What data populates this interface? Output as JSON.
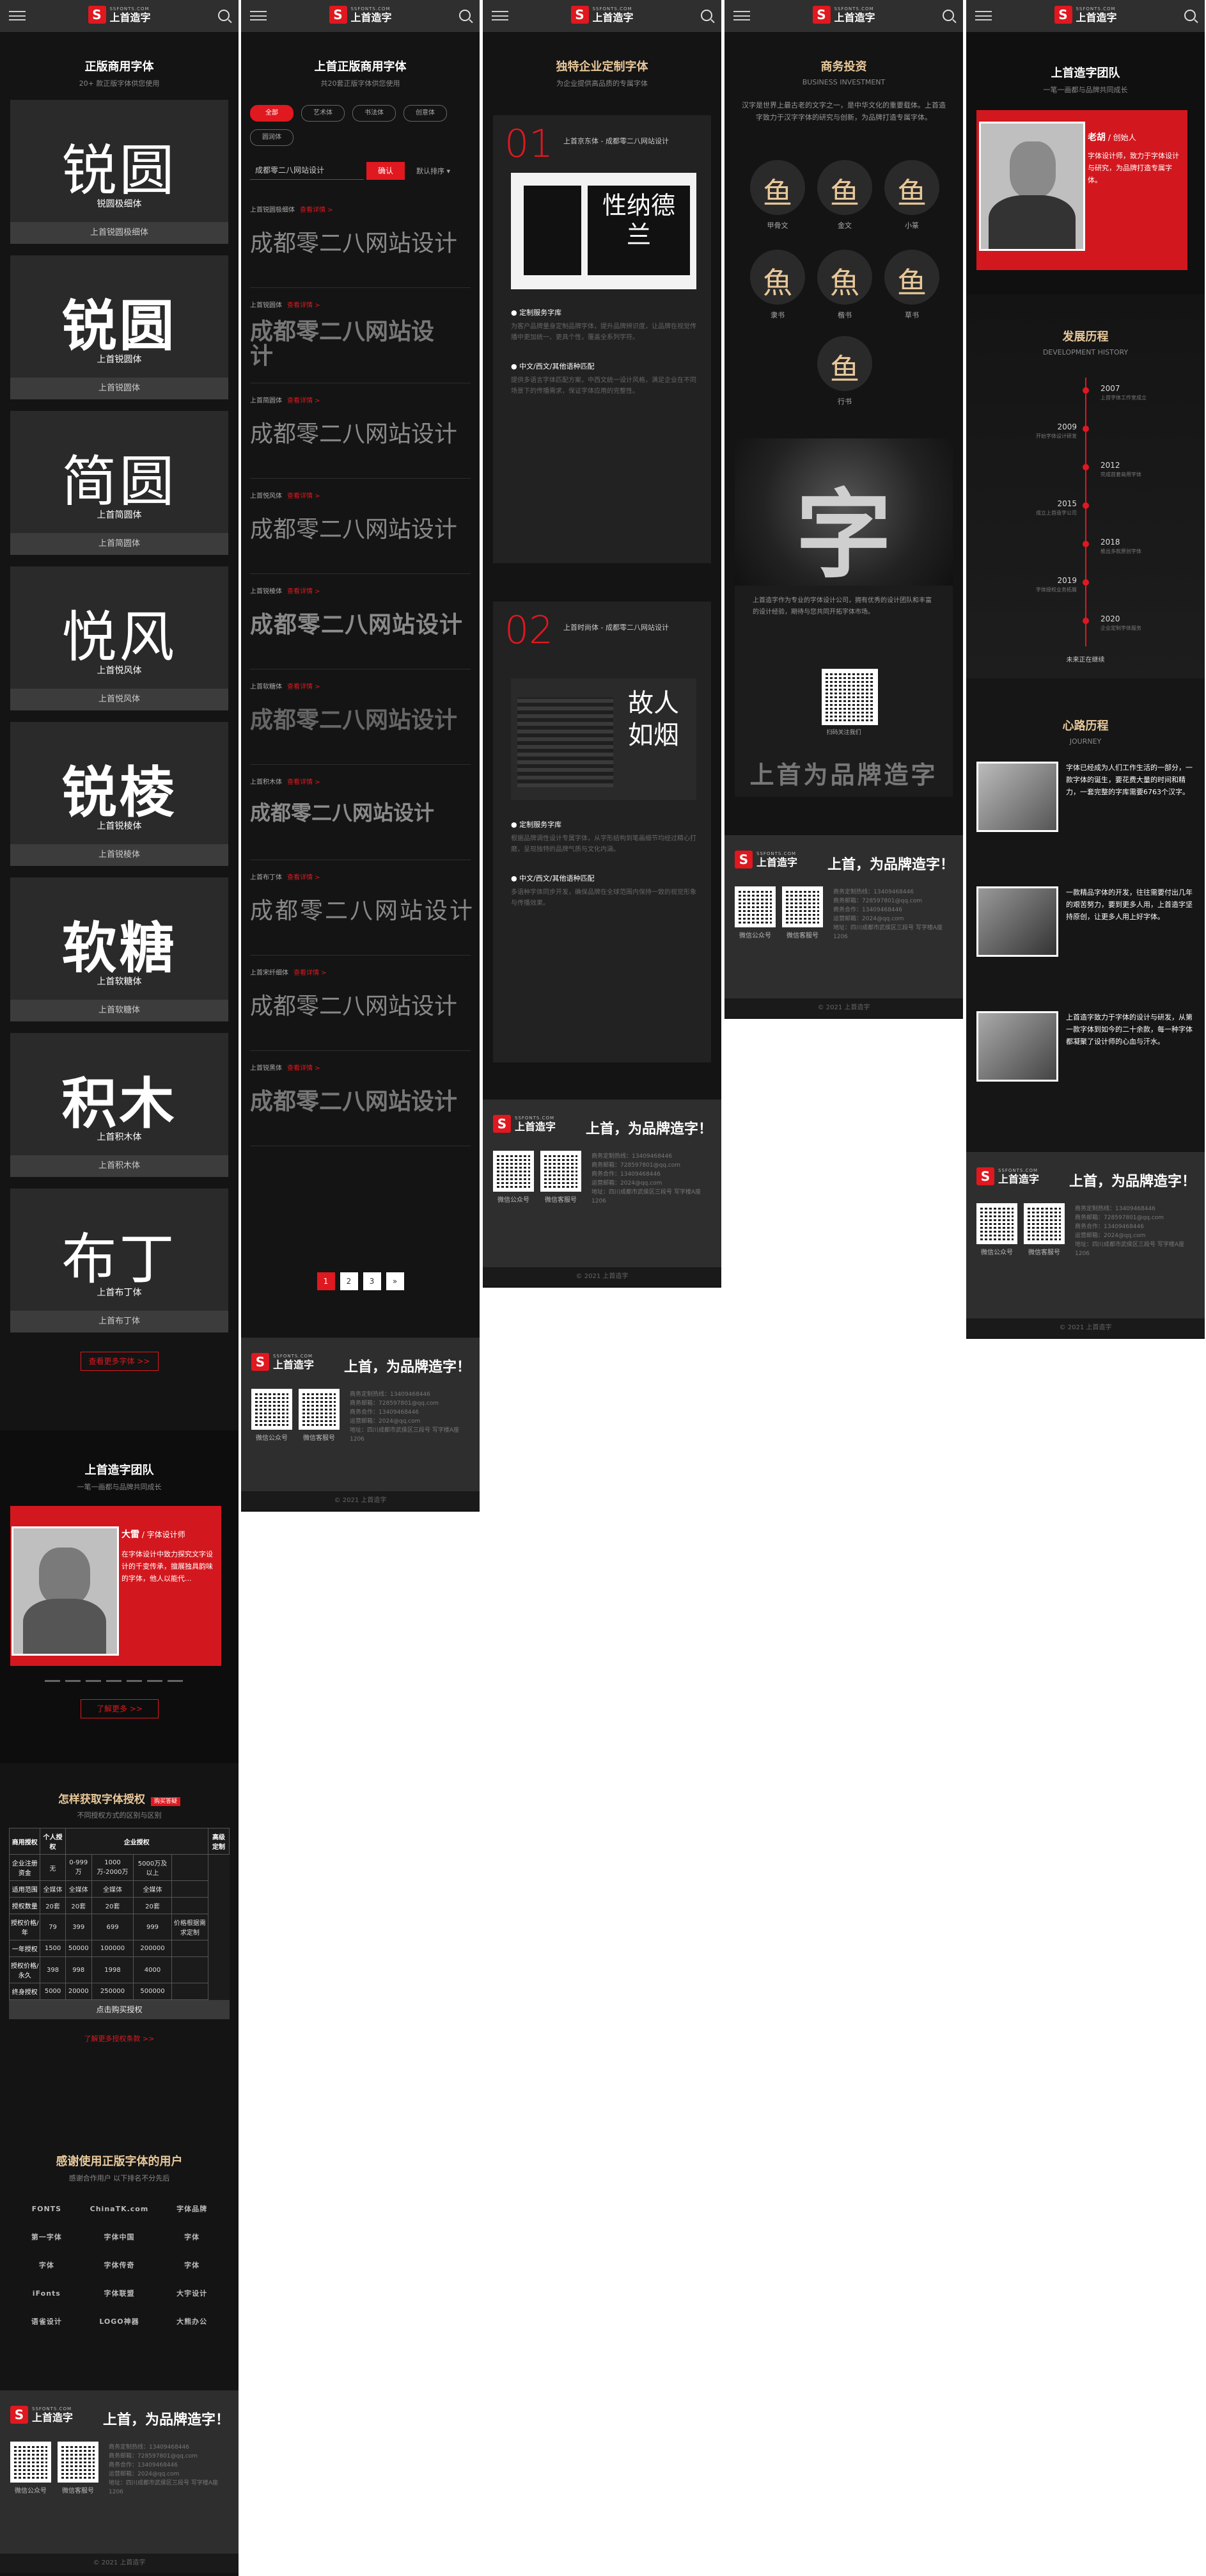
{
  "common": {
    "logo_domain": "SSFONTS.COM",
    "logo_name": "上首造字",
    "footer_slogan": "上首，为品牌造字！",
    "qr1_label": "微信公众号",
    "qr2_label": "微信客服号",
    "footer_info": [
      "商务定制热线：13409468446",
      "商务邮箱：728597801@qq.com",
      "商务合作：13409468446",
      "运营邮箱：2024@qq.com",
      "地址：四川成都市武侯区三段号 写字楼A座1206"
    ],
    "copyright": "© 2021 上首造字"
  },
  "p1": {
    "title": "正版商用字体",
    "subtitle": "20+ 款正版字体供您使用",
    "fonts": [
      {
        "big": "锐圆",
        "small": "锐圆极细体",
        "cap": "上首锐圆极细体"
      },
      {
        "big": "锐圆",
        "small": "上首锐圆体",
        "cap": "上首锐圆体"
      },
      {
        "big": "简圆",
        "small": "上首简圆体",
        "cap": "上首简圆体"
      },
      {
        "big": "悦风",
        "small": "上首悦风体",
        "cap": "上首悦风体"
      },
      {
        "big": "锐棱",
        "small": "上首锐棱体",
        "cap": "上首锐棱体"
      },
      {
        "big": "软糖",
        "small": "上首软糖体",
        "cap": "上首软糖体"
      },
      {
        "big": "积木",
        "small": "上首积木体",
        "cap": "上首积木体"
      },
      {
        "big": "布丁",
        "small": "上首布丁体",
        "cap": "上首布丁体"
      }
    ],
    "more_btn": "查看更多字体 >>",
    "team_title": "上首造字团队",
    "team_sub": "一笔一画都与品牌共同成长",
    "team_name": "大雷",
    "team_role": "/ 字体设计师",
    "team_desc": "在字体设计中致力探究文字设计的千变传承，擅展独具韵味的字体，他人以能代...",
    "team_btn": "了解更多 >>",
    "license_title": "怎样获取字体授权",
    "license_badge": "购买答疑",
    "license_sub": "不同授权方式的区别与区别",
    "table_head": [
      "商用授权",
      "个人授权",
      "企业授权",
      "",
      "",
      "高级定制"
    ],
    "table_rows": [
      [
        "企业注册资金",
        "无",
        "0-999万",
        "1000万-2000万",
        "5000万及以上",
        ""
      ],
      [
        "适用范围",
        "全媒体",
        "全媒体",
        "全媒体",
        "全媒体",
        ""
      ],
      [
        "授权数量",
        "20套",
        "20套",
        "20套",
        "20套",
        ""
      ],
      [
        "授权价格/年",
        "79",
        "399",
        "699",
        "999",
        "价格根据需求定制"
      ],
      [
        "一年授权",
        "1500",
        "50000",
        "100000",
        "200000",
        ""
      ],
      [
        "授权价格/永久",
        "398",
        "998",
        "1998",
        "4000",
        ""
      ],
      [
        "终身授权",
        "5000",
        "20000",
        "250000",
        "500000",
        ""
      ]
    ],
    "buy_btn": "点击购买授权",
    "license_link": "了解更多授权条款 >>",
    "partners_title": "感谢使用正版字体的用户",
    "partners_sub": "感谢合作用户 以下排名不分先后",
    "partners": [
      "FONTS",
      "ChinaTK.com",
      "字体品牌",
      "第一字体",
      "字体中国",
      "字体",
      "字体",
      "字体传奇",
      "字体",
      "iFonts",
      "字体联盟",
      "大宇设计",
      "语雀设计",
      "LOGO神器",
      "大熊办公"
    ]
  },
  "p2": {
    "title": "上首正版商用字体",
    "subtitle": "共20套正版字体供您使用",
    "tags": [
      "全部",
      "艺术体",
      "书法体",
      "创意体",
      "圆润体"
    ],
    "input_value": "成都零二八网站设计",
    "ok": "确认",
    "sort": "默认排序 ▾",
    "list": [
      {
        "name": "上首锐圆极细体",
        "link": "查看详情 >",
        "preview": "成都零二八网站设计"
      },
      {
        "name": "上首锐圆体",
        "link": "查看详情 >",
        "preview": "成都零二八网站设计"
      },
      {
        "name": "上首简圆体",
        "link": "查看详情 >",
        "preview": "成都零二八网站设计"
      },
      {
        "name": "上首悦风体",
        "link": "查看详情 >",
        "preview": "成都零二八网站设计"
      },
      {
        "name": "上首锐棱体",
        "link": "查看详情 >",
        "preview": "成都零二八网站设计"
      },
      {
        "name": "上首软糖体",
        "link": "查看详情 >",
        "preview": "成都零二八网站设计"
      },
      {
        "name": "上首积木体",
        "link": "查看详情 >",
        "preview": "成都零二八网站设计"
      },
      {
        "name": "上首布丁体",
        "link": "查看详情 >",
        "preview": "成都零二八网站设计"
      },
      {
        "name": "上首宋纤细体",
        "link": "查看详情 >",
        "preview": "成都零二八网站设计"
      },
      {
        "name": "上首锐黑体",
        "link": "查看详情 >",
        "preview": "成都零二八网站设计"
      }
    ],
    "pages": [
      "1",
      "2",
      "3",
      "»"
    ]
  },
  "p3": {
    "title": "独特企业定制字体",
    "subtitle": "为企业提供高品质的专属字体",
    "case1_num": "01",
    "case1_title": "上首京东体 - 成都零二八网站设计",
    "case1_img_text": "性纳德兰",
    "case1_b1": "● 定制服务字库",
    "case1_p1": "为客户品牌量身定制品牌字体，提升品牌辨识度，让品牌在视觉传播中更加统一、更具个性，覆盖全系列字符。",
    "case1_b2": "● 中文/西文/其他语种匹配",
    "case1_p2": "提供多语言字体匹配方案，中西文统一设计风格，满足企业在不同场景下的传播需求，保证字体应用的完整性。",
    "case2_num": "02",
    "case2_title": "上首时尚体 - 成都零二八网站设计",
    "case2_img_text": "故人如烟",
    "case2_b1": "● 定制服务字库",
    "case2_p1": "根据品牌调性设计专属字体，从字形结构到笔画细节均经过精心打磨，呈现独特的品牌气质与文化内涵。",
    "case2_b2": "● 中文/西文/其他语种匹配",
    "case2_p2": "多语种字体同步开发，确保品牌在全球范围内保持一致的视觉形象与传播效果。"
  },
  "p4": {
    "title": "商务投资",
    "subtitle": "BUSINESS INVESTMENT",
    "intro": "汉字是世界上最古老的文字之一，是中华文化的重要载体。上首造字致力于汉字字体的研究与创新，为品牌打造专属字体。",
    "scripts": [
      {
        "glyph": "鱼",
        "label": "甲骨文"
      },
      {
        "glyph": "鱼",
        "label": "金文"
      },
      {
        "glyph": "鱼",
        "label": "小篆"
      },
      {
        "glyph": "魚",
        "label": "隶书"
      },
      {
        "glyph": "魚",
        "label": "楷书"
      },
      {
        "glyph": "鱼",
        "label": "草书"
      },
      {
        "glyph": "鱼",
        "label": "行书"
      }
    ],
    "banner_char": "字",
    "invest_text": "上首造字作为专业的字体设计公司，拥有优秀的设计团队和丰富的设计经验，期待与您共同开拓字体市场。",
    "qr_caption": "扫码关注我们",
    "banner_slogan": "上首为品牌造字"
  },
  "p5": {
    "team_title": "上首造字团队",
    "team_sub": "一笔一画都与品牌共同成长",
    "name": "老胡",
    "role": "/ 创始人",
    "desc": "字体设计师，致力于字体设计与研究，为品牌打造专属字体。",
    "history_title": "发展历程",
    "history_sub": "DEVELOPMENT HISTORY",
    "timeline": [
      {
        "year": "2007",
        "desc": "上首字体工作室成立"
      },
      {
        "year": "2009",
        "desc": "开始字体设计研发"
      },
      {
        "year": "2012",
        "desc": "完成首套商用字体"
      },
      {
        "year": "2015",
        "desc": "成立上首造字公司"
      },
      {
        "year": "2018",
        "desc": "推出多款原创字体"
      },
      {
        "year": "2019",
        "desc": "字体授权业务拓展"
      },
      {
        "year": "2020",
        "desc": "企业定制字体服务"
      }
    ],
    "future": "未来正在继续",
    "journey_title": "心路历程",
    "journey_sub": "JOURNEY",
    "journey": [
      "字体已经成为人们工作生活的一部分，一款字体的诞生，要花费大量的时间和精力，一套完整的字库需要6763个汉字。",
      "一款精品字体的开发，往往需要付出几年的艰苦努力，要到更多人用，上首造字坚持原创，让更多人用上好字体。",
      "上首造字致力于字体的设计与研发，从第一款字体到如今的二十余款，每一种字体都凝聚了设计师的心血与汗水。"
    ]
  }
}
